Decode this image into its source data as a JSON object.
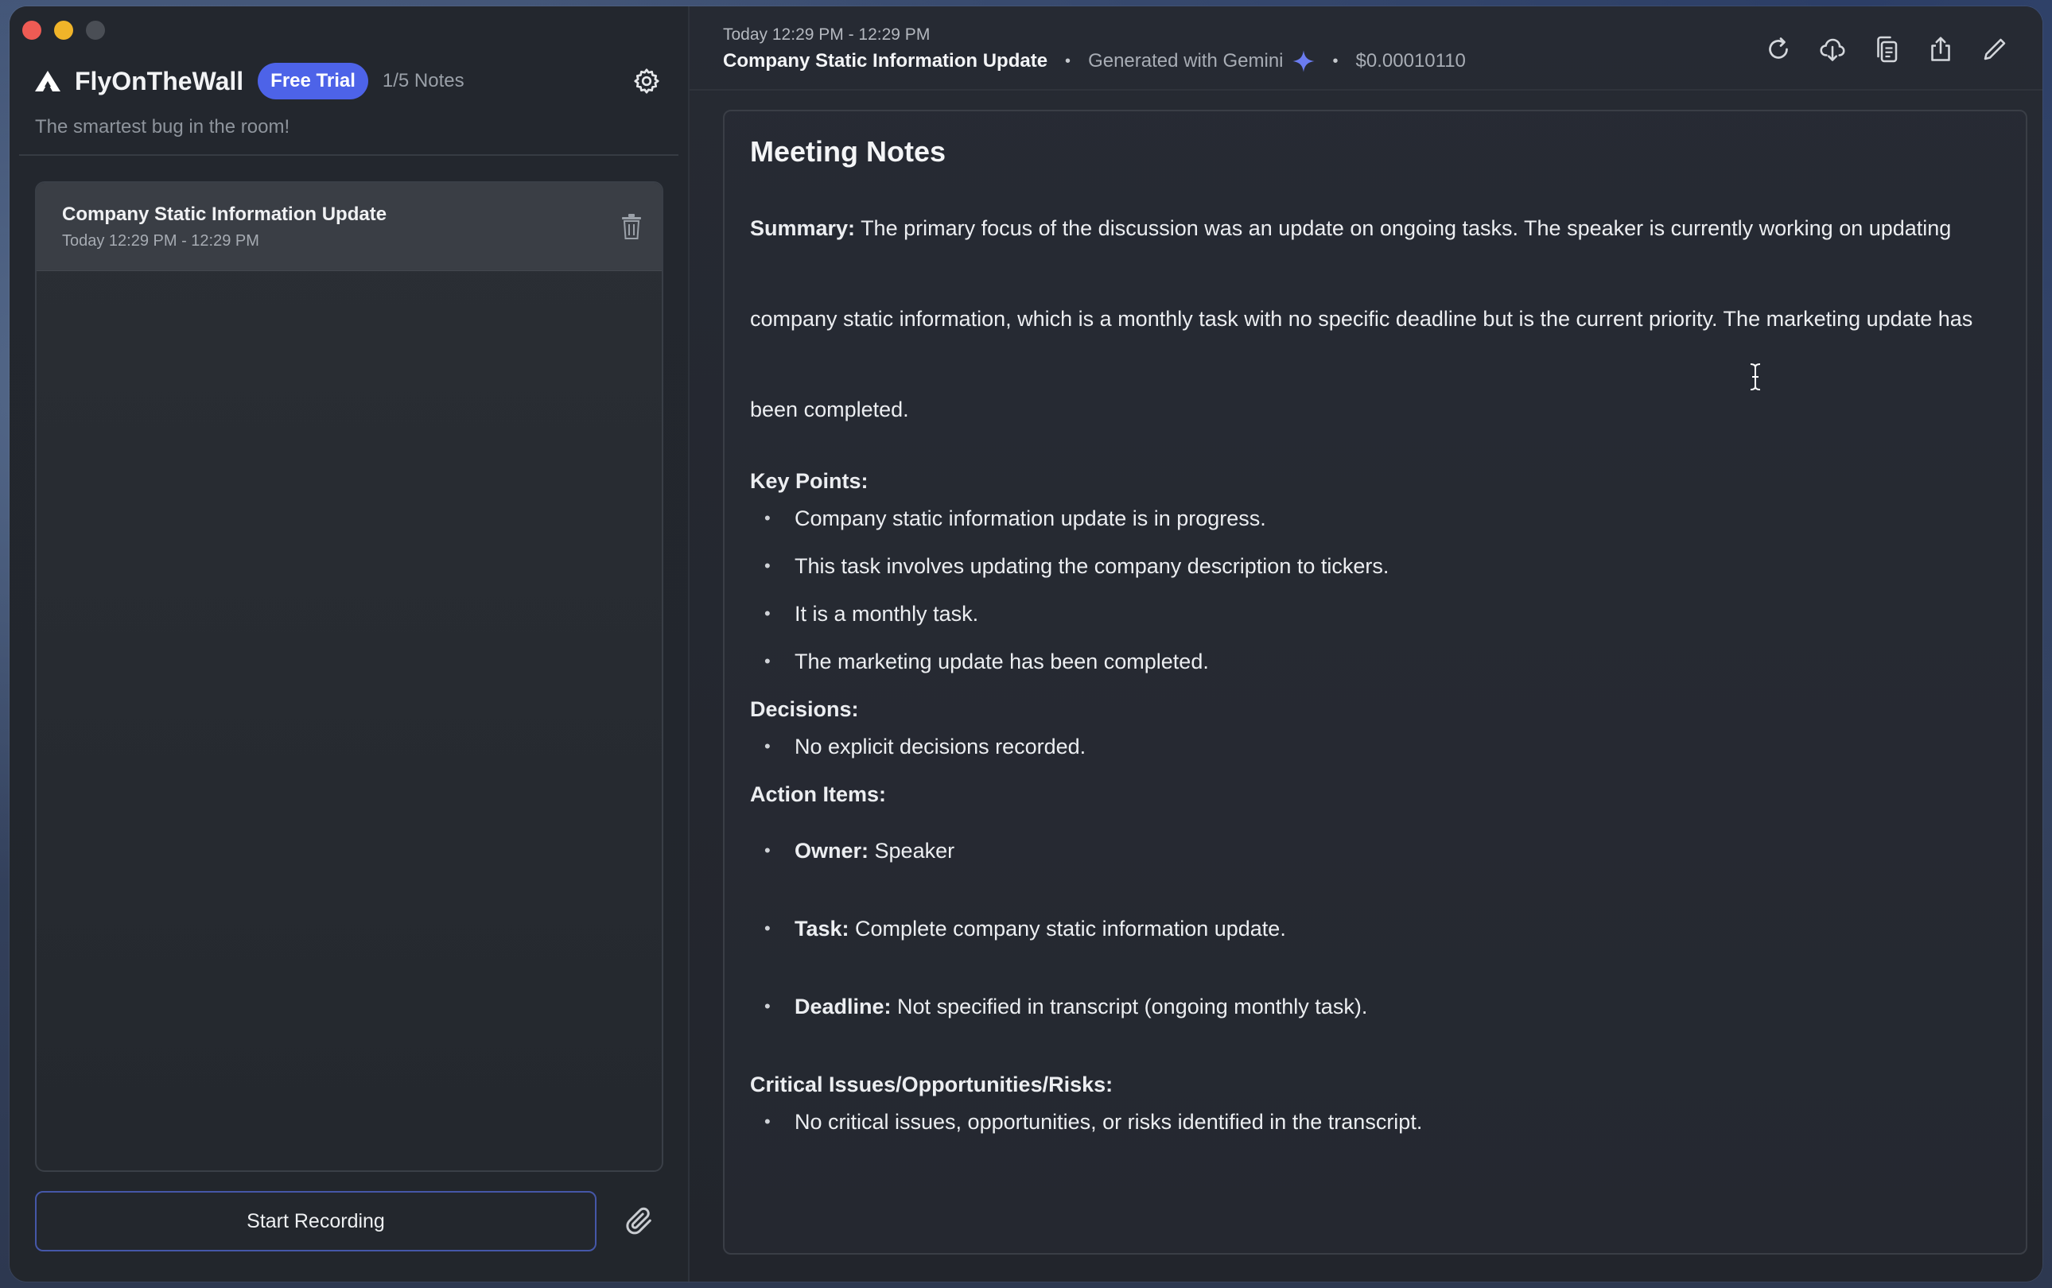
{
  "sidebar": {
    "app_name": "FlyOnTheWall",
    "badge": "Free Trial",
    "note_count": "1/5 Notes",
    "tagline": "The smartest bug in the room!",
    "notes": [
      {
        "title": "Company Static Information Update",
        "time": "Today 12:29 PM - 12:29 PM"
      }
    ],
    "record_label": "Start Recording"
  },
  "header": {
    "time": "Today 12:29 PM - 12:29 PM",
    "title": "Company Static Information Update",
    "generated": "Generated with Gemini",
    "cost": "$0.00010110"
  },
  "notes": {
    "title": "Meeting Notes",
    "summary_label": "Summary:",
    "summary": "The primary focus of the discussion was an update on ongoing tasks. The speaker is currently working on updating company static information, which is a monthly task with no specific deadline but is the current priority. The marketing update has been completed.",
    "key_points_label": "Key Points:",
    "key_points": [
      "Company static information update is in progress.",
      "This task involves updating the company description to tickers.",
      "It is a monthly task.",
      "The marketing update has been completed."
    ],
    "decisions_label": "Decisions:",
    "decisions": [
      "No explicit decisions recorded."
    ],
    "action_items_label": "Action Items:",
    "action_items": [
      {
        "label": "Owner:",
        "value": "Speaker"
      },
      {
        "label": "Task:",
        "value": "Complete company static information update."
      },
      {
        "label": "Deadline:",
        "value": "Not specified in transcript (ongoing monthly task)."
      }
    ],
    "critical_label": "Critical Issues/Opportunities/Risks:",
    "critical": [
      "No critical issues, opportunities, or risks identified in the transcript."
    ]
  },
  "colors": {
    "accent": "#4d63e8",
    "close": "#ee5b54",
    "minimize": "#f0b429"
  },
  "icons": [
    "logo-icon",
    "gear-icon",
    "trash-icon",
    "paperclip-icon",
    "sparkle-icon",
    "refresh-icon",
    "cloud-download-icon",
    "copy-icon",
    "share-icon",
    "edit-icon"
  ]
}
